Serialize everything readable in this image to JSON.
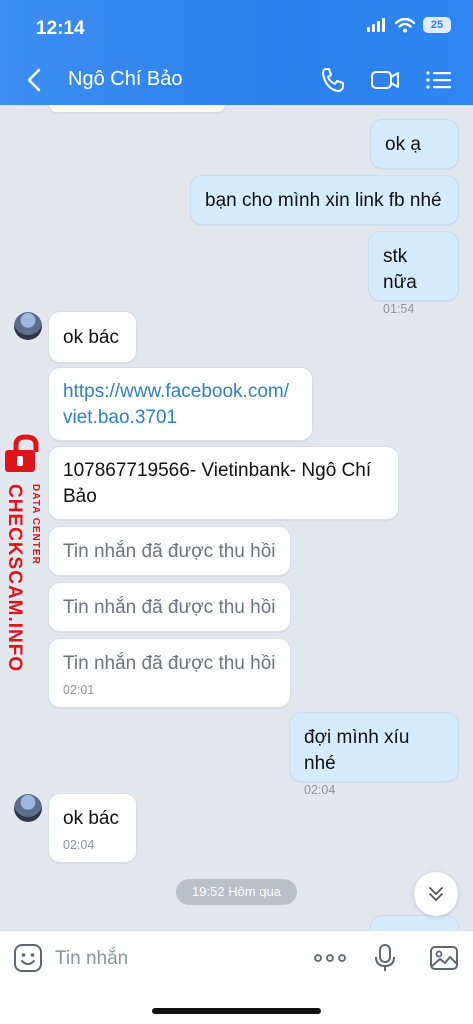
{
  "status_bar": {
    "time": "12:14",
    "battery": "25"
  },
  "header": {
    "contact_name": "Ngô Chí Bảo"
  },
  "messages": [
    {
      "text": "ok ạ"
    },
    {
      "text": "bạn cho mình xin link fb nhé"
    },
    {
      "text": "stk nữa",
      "time": "01:54"
    },
    {
      "text": "ok bác"
    },
    {
      "text": "https://www.facebook.com/",
      "text2": "viet.bao.3701"
    },
    {
      "text": "107867719566- Vietinbank- Ngô Chí",
      "text2": "Bảo"
    },
    {
      "text": "Tin nhắn đã được thu hồi"
    },
    {
      "text": "Tin nhắn đã được thu hồi"
    },
    {
      "text": "Tin nhắn đã được thu hồi",
      "time": "02:01"
    },
    {
      "text": "đợi mình xíu nhé",
      "time": "02:04"
    },
    {
      "text": "ok bác",
      "time": "02:04"
    }
  ],
  "date_divider": "19:52 Hôm qua",
  "watermark": {
    "main": "CHECKSCAM.INFO",
    "sub": "DATA CENTER"
  },
  "input": {
    "placeholder": "Tin nhắn"
  },
  "colors": {
    "header_blue": "#2c7fec",
    "outgoing_bubble": "#d6ecfc",
    "link": "#2f80c9",
    "watermark_red": "#e0151b"
  },
  "icons": [
    "back-arrow-icon",
    "phone-icon",
    "video-call-icon",
    "menu-list-icon",
    "scroll-down-icon",
    "sticker-icon",
    "more-icon",
    "microphone-icon",
    "image-icon"
  ]
}
